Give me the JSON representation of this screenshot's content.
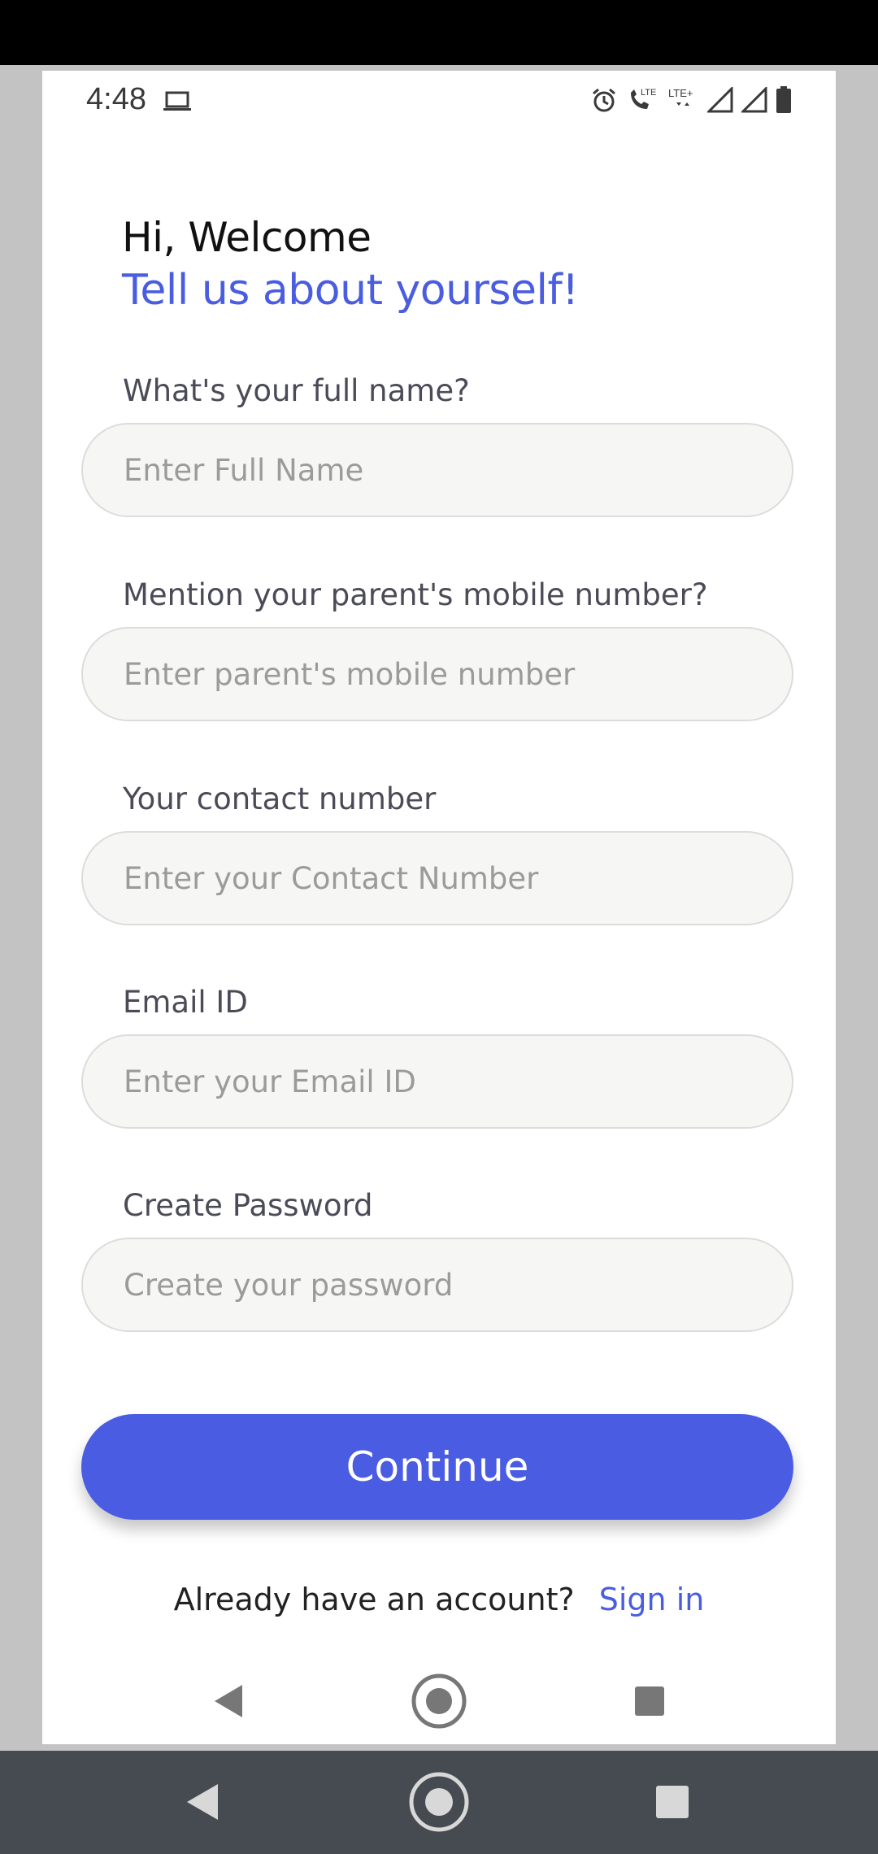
{
  "status_bar": {
    "time": "4:48",
    "icons": [
      "laptop-icon",
      "alarm-icon",
      "lte-call-icon",
      "lte-plus-icon",
      "signal-icon",
      "signal-icon",
      "battery-icon"
    ]
  },
  "header": {
    "greeting": "Hi, Welcome",
    "subtitle": "Tell us about yourself!"
  },
  "form": {
    "fields": [
      {
        "label": "What's your full name?",
        "placeholder": "Enter Full Name",
        "value": ""
      },
      {
        "label": "Mention your parent's mobile number?",
        "placeholder": "Enter parent's mobile number",
        "value": ""
      },
      {
        "label": "Your contact number",
        "placeholder": "Enter your Contact Number",
        "value": ""
      },
      {
        "label": "Email ID",
        "placeholder": "Enter your Email ID",
        "value": ""
      },
      {
        "label": "Create Password",
        "placeholder": "Create your password",
        "value": ""
      }
    ],
    "continue_label": "Continue"
  },
  "footer": {
    "question": "Already have an account?",
    "signin_label": "Sign in"
  },
  "navigation": {
    "buttons": [
      "back-icon",
      "home-icon",
      "recents-icon"
    ]
  },
  "colors": {
    "accent": "#4a5de2",
    "input_bg": "#f6f7f5",
    "nav_bar": "#454b50"
  }
}
